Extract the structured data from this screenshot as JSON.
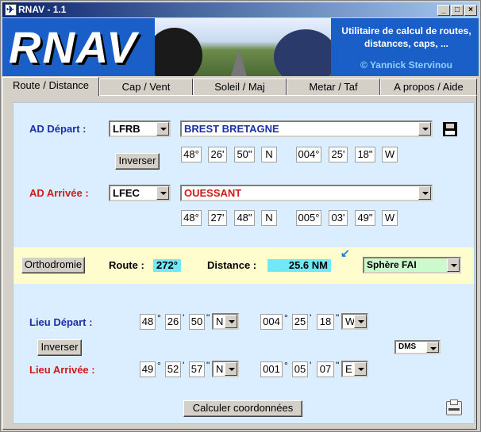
{
  "window": {
    "title": "RNAV - 1.1"
  },
  "banner": {
    "logo": "RNAV",
    "description": "Utilitaire de calcul de routes, distances, caps, ...",
    "author": "© Yannick Stervinou"
  },
  "tabs": [
    "Route / Distance",
    "Cap / Vent",
    "Soleil / Maj",
    "Metar / Taf",
    "A propos / Aide"
  ],
  "depart": {
    "label": "AD Départ :",
    "code": "LFRB",
    "name": "BREST BRETAGNE",
    "lat": [
      "48°",
      "26'",
      "50\"",
      "N"
    ],
    "lon": [
      "004°",
      "25'",
      "18\"",
      "W"
    ]
  },
  "inverser_label": "Inverser",
  "arrivee": {
    "label": "AD Arrivée :",
    "code": "LFEC",
    "name": "OUESSANT",
    "lat": [
      "48°",
      "27'",
      "48\"",
      "N"
    ],
    "lon": [
      "005°",
      "03'",
      "49\"",
      "W"
    ]
  },
  "route": {
    "ortho_label": "Orthodromie",
    "route_label": "Route :",
    "route_value": "272°",
    "distance_label": "Distance :",
    "distance_value": "25.6 NM",
    "model": "Sphère FAI"
  },
  "lieu_depart": {
    "label": "Lieu Départ :",
    "lat": [
      "48",
      "26",
      "50"
    ],
    "lat_hemi": "N",
    "lon": [
      "004",
      "25",
      "18"
    ],
    "lon_hemi": "W"
  },
  "lieu_arrivee": {
    "label": "Lieu Arrivée :",
    "lat": [
      "49",
      "52",
      "57"
    ],
    "lat_hemi": "N",
    "lon": [
      "001",
      "05",
      "07"
    ],
    "lon_hemi": "E"
  },
  "format": "DMS",
  "calc_label": "Calculer coordonnées",
  "colors": {
    "banner": "#1a5fc8",
    "route_highlight": "#70e8f8",
    "band": "#fffccd",
    "panel": "#dbeeff"
  }
}
